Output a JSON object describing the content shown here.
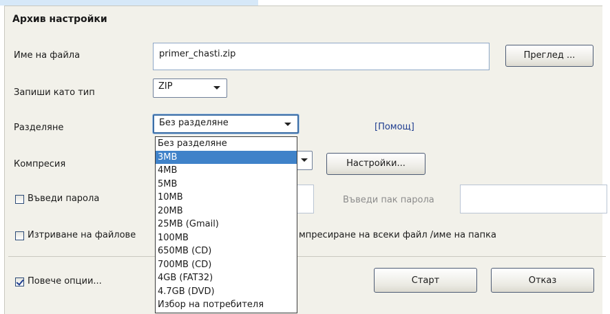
{
  "header": {
    "title": "Архив настройки"
  },
  "filename": {
    "label": "Име на файла",
    "value": "primer_chasti.zip",
    "browse_label": "Преглед ..."
  },
  "save_type": {
    "label": "Запиши като тип",
    "value": "ZIP"
  },
  "split": {
    "label": "Разделяне",
    "value": "Без разделяне",
    "help_label": "[Помощ]",
    "options": [
      "Без разделяне",
      "3MB",
      "4MB",
      "5MB",
      "10MB",
      "20MB",
      "25MB (Gmail)",
      "100MB",
      "650MB (CD)",
      "700MB (CD)",
      "4GB (FAT32)",
      "4.7GB (DVD)",
      "Избор на потребителя"
    ],
    "highlighted": "3MB"
  },
  "compression": {
    "label": "Компресия",
    "settings_label": "Настройки..."
  },
  "password": {
    "checkbox_label": "Въведи парола",
    "confirm_label": "Въведи пак парола",
    "checked": false
  },
  "delete_files": {
    "checkbox_label": "Изтриване на файлове",
    "checked": false
  },
  "separate_archive": {
    "label": "мпресиране на всеки файл /име на папка"
  },
  "more_options": {
    "checkbox_label": "Повече опции...",
    "checked": true
  },
  "actions": {
    "start_label": "Старт",
    "cancel_label": "Отказ"
  }
}
